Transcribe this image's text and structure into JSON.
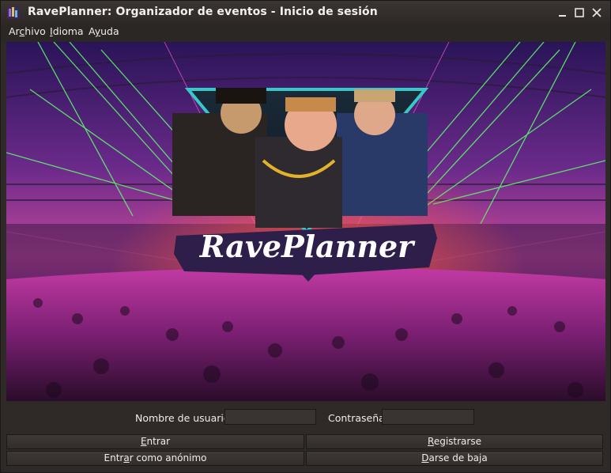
{
  "window": {
    "title": "RavePlanner: Organizador de eventos - Inicio de sesión"
  },
  "menu": {
    "archivo": {
      "pre": "Ar",
      "key": "c",
      "post": "hivo"
    },
    "idioma": {
      "pre": "",
      "key": "I",
      "post": "dioma"
    },
    "ayuda": {
      "pre": "A",
      "key": "y",
      "post": "uda"
    }
  },
  "banner": {
    "logo_text": "RavePlanner"
  },
  "login": {
    "username_label": "Nombre de usuario:",
    "username_value": "",
    "password_label": "Contraseña:",
    "password_value": ""
  },
  "buttons": {
    "entrar": {
      "pre": "",
      "key": "E",
      "post": "ntrar"
    },
    "registrarse": {
      "pre": "",
      "key": "R",
      "post": "egistrarse"
    },
    "anonimo": {
      "pre": "Entr",
      "key": "a",
      "post": "r como anónimo"
    },
    "baja": {
      "pre": "",
      "key": "D",
      "post": "arse de baja"
    }
  },
  "colors": {
    "window_bg": "#2f2a27",
    "titlebar": "#3b3532",
    "logo_bg": "#2e1e4a",
    "laser_green": "#5dff6a",
    "crowd_magenta": "#b02aa8"
  }
}
